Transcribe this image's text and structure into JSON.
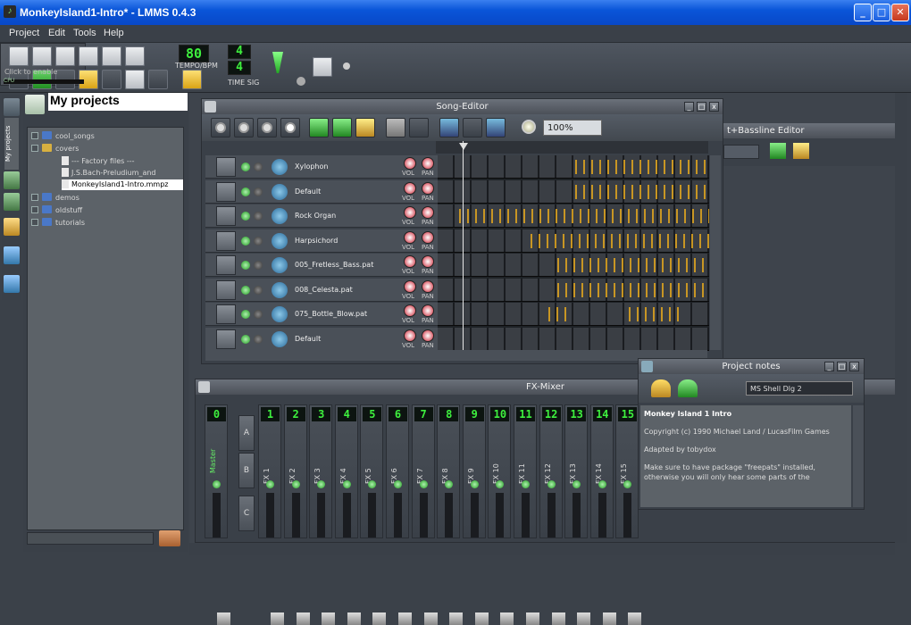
{
  "window": {
    "title": "MonkeyIsland1-Intro* - LMMS 0.4.3",
    "min_label": "_",
    "max_label": "□",
    "close_label": "✕"
  },
  "menu": [
    "Project",
    "Edit",
    "Tools",
    "Help"
  ],
  "toolbar": {
    "tempo_value": "80",
    "tempo_label": "TEMPO/BPM",
    "timesig_num": "4",
    "timesig_den": "4",
    "timesig_label": "TIME SIG",
    "cpu_label": "Click to enable",
    "cpu_bar_label": "CPU"
  },
  "sidebar": {
    "tab_label": "My projects"
  },
  "projects": {
    "title": "My projects",
    "items": [
      {
        "label": "cool_songs",
        "type": "folder"
      },
      {
        "label": "covers",
        "type": "folder-open"
      },
      {
        "label": "--- Factory files ---",
        "type": "doc"
      },
      {
        "label": "J.S.Bach-Preludium_and",
        "type": "doc"
      },
      {
        "label": "MonkeyIsland1-Intro.mmpz",
        "type": "doc",
        "selected": true
      },
      {
        "label": "demos",
        "type": "folder"
      },
      {
        "label": "oldstuff",
        "type": "folder"
      },
      {
        "label": "tutorials",
        "type": "folder"
      }
    ]
  },
  "song_editor": {
    "title": "Song-Editor",
    "zoom": "100%",
    "tracks": [
      {
        "name": "Xylophon"
      },
      {
        "name": "Default"
      },
      {
        "name": "Rock Organ"
      },
      {
        "name": "Harpsichord"
      },
      {
        "name": "005_Fretless_Bass.pat"
      },
      {
        "name": "008_Celesta.pat"
      },
      {
        "name": "075_Bottle_Blow.pat"
      },
      {
        "name": "Default"
      }
    ],
    "vol_label": "VOL",
    "pan_label": "PAN"
  },
  "beat_editor": {
    "title_partial": "t+Bassline Editor"
  },
  "fx_mixer": {
    "title": "FX-Mixer",
    "master_num": "0",
    "master_label": "Master",
    "buttons": [
      "A",
      "B",
      "C"
    ],
    "channels": [
      {
        "num": "1",
        "label": "FX 1"
      },
      {
        "num": "2",
        "label": "FX 2"
      },
      {
        "num": "3",
        "label": "FX 3"
      },
      {
        "num": "4",
        "label": "FX 4"
      },
      {
        "num": "5",
        "label": "FX 5"
      },
      {
        "num": "6",
        "label": "FX 6"
      },
      {
        "num": "7",
        "label": "FX 7"
      },
      {
        "num": "8",
        "label": "FX 8"
      },
      {
        "num": "9",
        "label": "FX 9"
      },
      {
        "num": "10",
        "label": "FX 10"
      },
      {
        "num": "11",
        "label": "FX 11"
      },
      {
        "num": "12",
        "label": "FX 12"
      },
      {
        "num": "13",
        "label": "FX 13"
      },
      {
        "num": "14",
        "label": "FX 14"
      },
      {
        "num": "15",
        "label": "FX 15"
      }
    ]
  },
  "project_notes": {
    "title": "Project notes",
    "font": "MS Shell Dlg 2",
    "heading": "Monkey Island 1 Intro",
    "lines": [
      "Copyright (c) 1990 Michael Land / LucasFilm Games",
      "Adapted by tobydox",
      "Make sure to have package \"freepats\" installed, otherwise you will only hear some parts of the"
    ]
  },
  "colors": {
    "accent": "#3ef03e",
    "notes": "#d8a020",
    "titlebar": "#0a55d8"
  }
}
